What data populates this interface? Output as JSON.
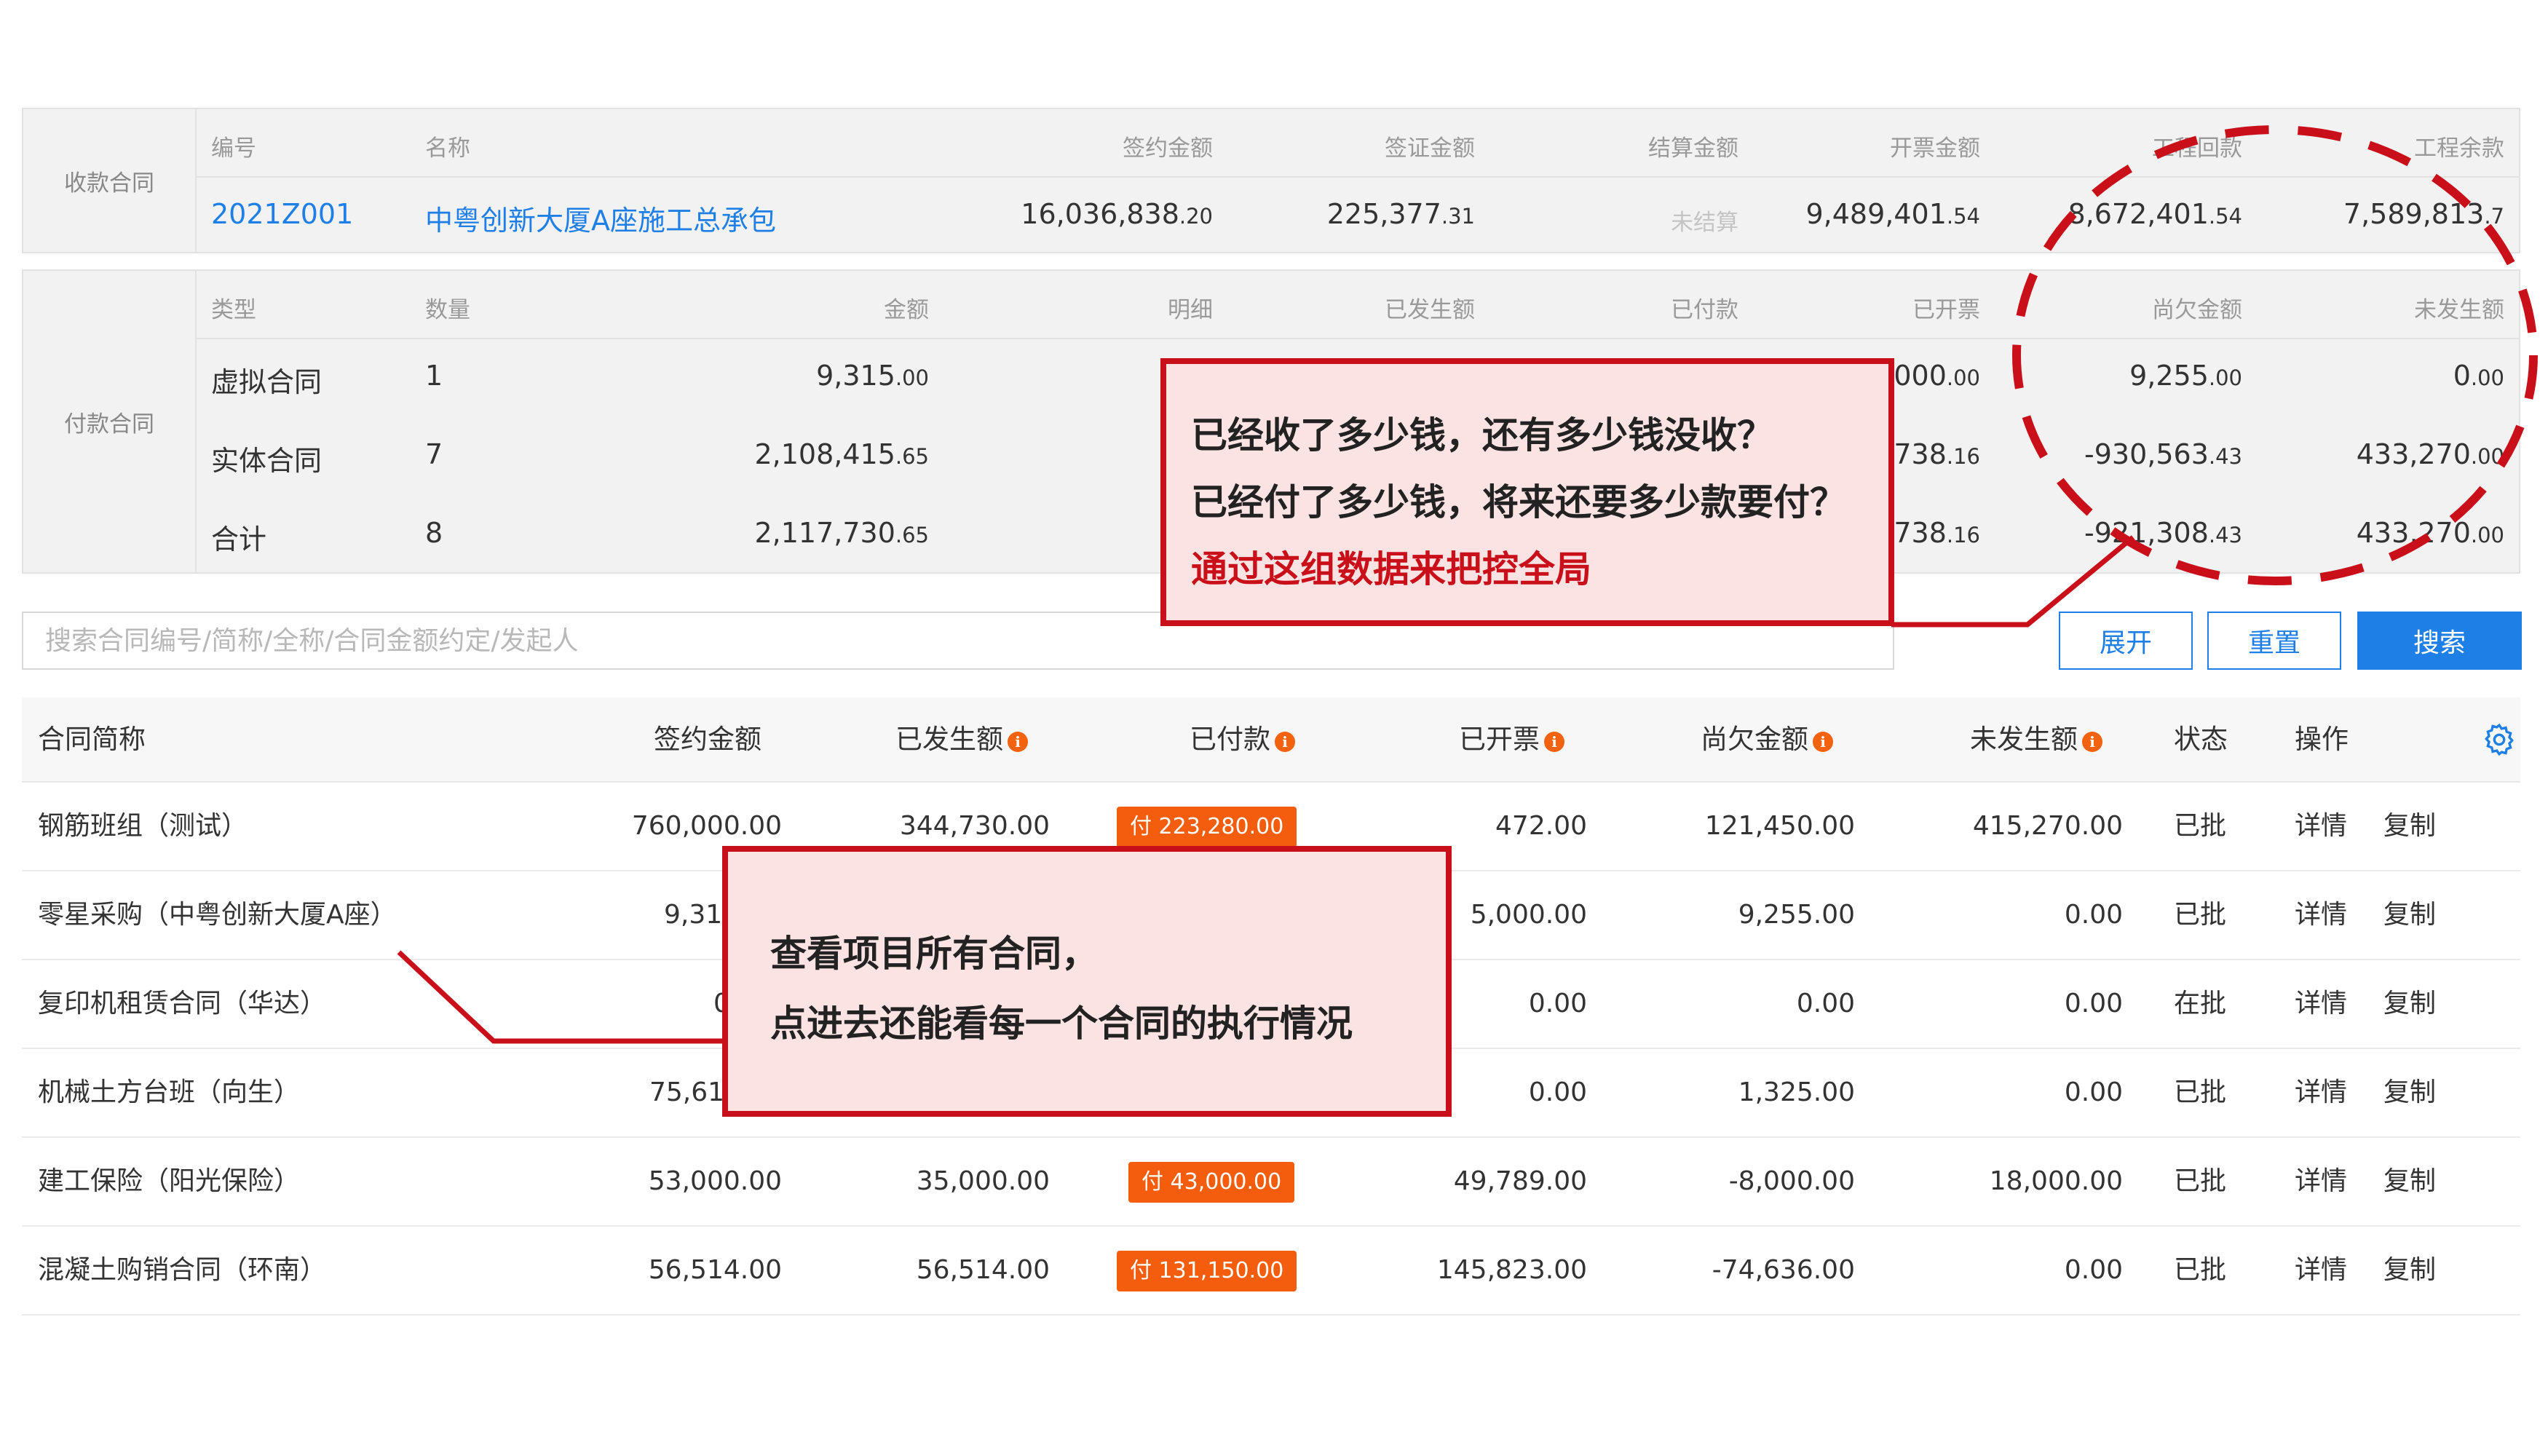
{
  "receipt_contract": {
    "side_label": "收款合同",
    "headers": [
      "编号",
      "名称",
      "签约金额",
      "签证金额",
      "结算金额",
      "开票金额",
      "工程回款",
      "工程余款"
    ],
    "code": "2021Z001",
    "name": "中粤创新大厦A座施工总承包",
    "sign_amount": {
      "int": "16,036,838",
      "dec": ".20"
    },
    "visa_amount": {
      "int": "225,377",
      "dec": ".31"
    },
    "settle_amount": "未结算",
    "invoice_amount": {
      "int": "9,489,401",
      "dec": ".54"
    },
    "project_receipt": {
      "int": "8,672,401",
      "dec": ".54"
    },
    "project_balance": {
      "int": "7,589,813",
      "dec": ".7"
    }
  },
  "payment_contract": {
    "side_label": "付款合同",
    "headers": [
      "类型",
      "数量",
      "金额",
      "明细",
      "已发生额",
      "已付款",
      "已开票",
      "尚欠金额",
      "未发生额"
    ],
    "rows": [
      {
        "type": "虚拟合同",
        "count": "1",
        "amount": {
          "int": "9,315",
          "dec": ".00"
        },
        "invoiced": {
          "int": ",000",
          "dec": ".00"
        },
        "owed": {
          "int": "9,255",
          "dec": ".00"
        },
        "not_occurred": {
          "int": "0",
          "dec": ".00"
        }
      },
      {
        "type": "实体合同",
        "count": "7",
        "amount": {
          "int": "2,108,415",
          "dec": ".65"
        },
        "invoiced": {
          "int": ",738",
          "dec": ".16"
        },
        "owed": {
          "int": "-930,563",
          "dec": ".43"
        },
        "not_occurred": {
          "int": "433,270",
          "dec": ".00"
        }
      },
      {
        "type": "合计",
        "count": "8",
        "amount": {
          "int": "2,117,730",
          "dec": ".65"
        },
        "invoiced": {
          "int": ",738",
          "dec": ".16"
        },
        "owed": {
          "int": "-921,308",
          "dec": ".43"
        },
        "not_occurred": {
          "int": "433,270",
          "dec": ".00"
        }
      }
    ]
  },
  "search": {
    "placeholder": "搜索合同编号/简称/全称/合同金额约定/发起人",
    "expand": "展开",
    "reset": "重置",
    "submit": "搜索"
  },
  "table": {
    "headers": {
      "name": "合同简称",
      "sign": "签约金额",
      "occurred": "已发生额",
      "paid": "已付款",
      "invoiced": "已开票",
      "owed": "尚欠金额",
      "not_occurred": "未发生额",
      "status": "状态",
      "ops": "操作"
    },
    "info_glyph": "i",
    "detail_label": "详情",
    "copy_label": "复制",
    "rows": [
      {
        "name": "钢筋班组（测试）",
        "sign": "760,000.00",
        "occurred": "344,730.00",
        "paid": "付 223,280.00",
        "invoiced": "472.00",
        "owed": "121,450.00",
        "not_occurred": "415,270.00",
        "status": "已批"
      },
      {
        "name": "零星采购（中粤创新大厦A座）",
        "sign": "9,315",
        "occurred": "",
        "paid": "",
        "invoiced": "5,000.00",
        "owed": "9,255.00",
        "not_occurred": "0.00",
        "status": "已批"
      },
      {
        "name": "复印机租赁合同（华达）",
        "sign": "0",
        "occurred": "",
        "paid": "",
        "invoiced": "0.00",
        "owed": "0.00",
        "not_occurred": "0.00",
        "status": "在批"
      },
      {
        "name": "机械土方台班（向生）",
        "sign": "75,618",
        "occurred": "",
        "paid": "",
        "invoiced": "0.00",
        "owed": "1,325.00",
        "not_occurred": "0.00",
        "status": "已批"
      },
      {
        "name": "建工保险（阳光保险）",
        "sign": "53,000.00",
        "occurred": "35,000.00",
        "paid": "付 43,000.00",
        "invoiced": "49,789.00",
        "owed": "-8,000.00",
        "not_occurred": "18,000.00",
        "status": "已批"
      },
      {
        "name": "混凝土购销合同（环南）",
        "sign": "56,514.00",
        "occurred": "56,514.00",
        "paid": "付 131,150.00",
        "invoiced": "145,823.00",
        "owed": "-74,636.00",
        "not_occurred": "0.00",
        "status": "已批"
      }
    ]
  },
  "annotations": {
    "callout_top": [
      "已经收了多少钱，还有多少钱没收？",
      "已经付了多少钱，将来还要多少款要付？",
      "通过这组数据来把控全局"
    ],
    "callout_bottom": [
      "查看项目所有合同，",
      "点进去还能看每一个合同的执行情况"
    ]
  },
  "colors": {
    "link": "#1e7fe6",
    "badge": "#f45d0d",
    "annotation": "#c9101a",
    "callout_bg": "#fbe3e3"
  }
}
